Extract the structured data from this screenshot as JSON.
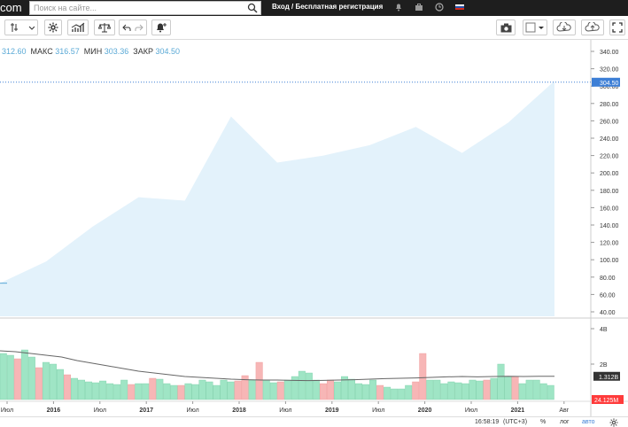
{
  "topbar": {
    "logo": "com",
    "search_placeholder": "Поиск на сайте...",
    "login_text": "Вход / Бесплатная регистрация"
  },
  "ohlc": {
    "open_value": "312.60",
    "high_label": "МАКС",
    "high_value": "316.57",
    "low_label": "МИН",
    "low_value": "303.36",
    "close_label": "ЗАКР",
    "close_value": "304.50"
  },
  "price_axis": {
    "ticks": [
      "340.00",
      "320.00",
      "300.00",
      "280.00",
      "260.00",
      "240.00",
      "220.00",
      "200.00",
      "180.00",
      "160.00",
      "140.00",
      "120.00",
      "100.00",
      "80.00",
      "60.00",
      "40.00"
    ],
    "current_label": "304.50"
  },
  "volume_axis": {
    "ticks": [
      "4B",
      "2B"
    ],
    "ma_label": "1.312B",
    "current_label": "24.125M"
  },
  "time_axis": {
    "labels": [
      "Июл",
      "2016",
      "Июл",
      "2017",
      "Июл",
      "2018",
      "Июл",
      "2019",
      "Июл",
      "2020",
      "Июл",
      "2021",
      "Авг"
    ]
  },
  "status": {
    "time": "16:58:19",
    "timezone": "(UTC+3)",
    "percent_label": "%",
    "log_label": "лог",
    "auto_label": "авто"
  },
  "colors": {
    "area_fill": "#e3f2fb",
    "vol_up": "#9fe5c5",
    "vol_down": "#f7b6b6",
    "price_label": "#3d7fd6",
    "volume_label": "#ff3b3b"
  },
  "chart_data": {
    "type": "area",
    "price_points": [
      [
        0,
        73
      ],
      [
        1,
        98
      ],
      [
        2,
        138
      ],
      [
        3,
        172
      ],
      [
        4,
        168
      ],
      [
        5,
        265
      ],
      [
        6,
        212
      ],
      [
        7,
        220
      ],
      [
        8,
        232
      ],
      [
        9,
        253
      ],
      [
        10,
        223
      ],
      [
        11,
        258
      ],
      [
        12,
        306
      ]
    ],
    "volume_series": [
      {
        "v": 2.6,
        "up": true
      },
      {
        "v": 2.5,
        "up": true
      },
      {
        "v": 2.3,
        "up": false
      },
      {
        "v": 2.8,
        "up": true
      },
      {
        "v": 2.4,
        "up": true
      },
      {
        "v": 1.8,
        "up": false
      },
      {
        "v": 2.1,
        "up": true
      },
      {
        "v": 2.0,
        "up": true
      },
      {
        "v": 1.7,
        "up": true
      },
      {
        "v": 1.4,
        "up": false
      },
      {
        "v": 1.2,
        "up": true
      },
      {
        "v": 1.1,
        "up": true
      },
      {
        "v": 1.0,
        "up": true
      },
      {
        "v": 0.95,
        "up": true
      },
      {
        "v": 1.05,
        "up": true
      },
      {
        "v": 0.9,
        "up": true
      },
      {
        "v": 0.85,
        "up": true
      },
      {
        "v": 1.1,
        "up": true
      },
      {
        "v": 0.85,
        "up": false
      },
      {
        "v": 0.9,
        "up": true
      },
      {
        "v": 0.9,
        "up": true
      },
      {
        "v": 1.2,
        "up": false
      },
      {
        "v": 1.15,
        "up": true
      },
      {
        "v": 0.9,
        "up": true
      },
      {
        "v": 0.8,
        "up": true
      },
      {
        "v": 0.8,
        "up": false
      },
      {
        "v": 0.9,
        "up": true
      },
      {
        "v": 0.85,
        "up": true
      },
      {
        "v": 1.1,
        "up": true
      },
      {
        "v": 1.0,
        "up": true
      },
      {
        "v": 0.8,
        "up": true
      },
      {
        "v": 1.1,
        "up": true
      },
      {
        "v": 1.0,
        "up": true
      },
      {
        "v": 1.05,
        "up": false
      },
      {
        "v": 1.35,
        "up": false
      },
      {
        "v": 1.1,
        "up": true
      },
      {
        "v": 2.1,
        "up": false
      },
      {
        "v": 1.1,
        "up": true
      },
      {
        "v": 0.95,
        "up": true
      },
      {
        "v": 1.0,
        "up": false
      },
      {
        "v": 1.1,
        "up": true
      },
      {
        "v": 1.3,
        "up": true
      },
      {
        "v": 1.6,
        "up": true
      },
      {
        "v": 1.5,
        "up": true
      },
      {
        "v": 1.1,
        "up": true
      },
      {
        "v": 0.9,
        "up": false
      },
      {
        "v": 1.1,
        "up": false
      },
      {
        "v": 1.0,
        "up": true
      },
      {
        "v": 1.3,
        "up": true
      },
      {
        "v": 1.15,
        "up": true
      },
      {
        "v": 0.9,
        "up": true
      },
      {
        "v": 0.85,
        "up": true
      },
      {
        "v": 1.1,
        "up": true
      },
      {
        "v": 0.8,
        "up": false
      },
      {
        "v": 0.7,
        "up": true
      },
      {
        "v": 0.6,
        "up": true
      },
      {
        "v": 0.6,
        "up": true
      },
      {
        "v": 0.8,
        "up": true
      },
      {
        "v": 1.0,
        "up": false
      },
      {
        "v": 2.6,
        "up": false
      },
      {
        "v": 1.1,
        "up": true
      },
      {
        "v": 1.1,
        "up": true
      },
      {
        "v": 0.9,
        "up": true
      },
      {
        "v": 1.0,
        "up": true
      },
      {
        "v": 0.95,
        "up": true
      },
      {
        "v": 0.9,
        "up": true
      },
      {
        "v": 1.1,
        "up": true
      },
      {
        "v": 1.05,
        "up": true
      },
      {
        "v": 1.1,
        "up": false
      },
      {
        "v": 1.2,
        "up": true
      },
      {
        "v": 2.0,
        "up": true
      },
      {
        "v": 1.3,
        "up": true
      },
      {
        "v": 1.3,
        "up": false
      },
      {
        "v": 0.9,
        "up": true
      },
      {
        "v": 1.1,
        "up": true
      },
      {
        "v": 1.1,
        "up": true
      },
      {
        "v": 0.9,
        "up": true
      },
      {
        "v": 0.8,
        "up": true
      }
    ],
    "volume_ma": [
      2.75,
      2.7,
      2.6,
      2.5,
      2.4,
      2.2,
      2.05,
      1.9,
      1.75,
      1.6,
      1.5,
      1.4,
      1.3,
      1.25,
      1.2,
      1.15,
      1.12,
      1.1,
      1.1,
      1.08,
      1.07,
      1.08,
      1.1,
      1.12,
      1.15,
      1.18,
      1.2,
      1.22,
      1.25,
      1.28,
      1.3,
      1.28,
      1.3,
      1.31,
      1.3,
      1.31,
      1.31
    ],
    "ylim": [
      40,
      340
    ],
    "vol_max": 4.5
  }
}
